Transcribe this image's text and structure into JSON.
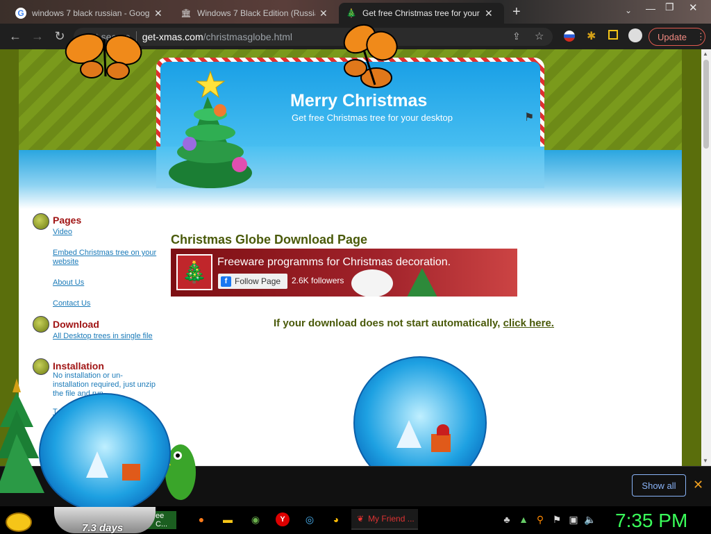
{
  "tabs": [
    {
      "title": "windows 7 black russian - Googl",
      "icon": "google-icon"
    },
    {
      "title": "Windows 7 Black Edition (Russia",
      "icon": "archive-icon"
    },
    {
      "title": "Get free Christmas tree for your",
      "icon": "tree-icon",
      "active": true
    }
  ],
  "toolbar": {
    "not_secure": "Not secure",
    "url_domain": "get-xmas.com",
    "url_path": "/christmasglobe.html",
    "update_label": "Update"
  },
  "banner": {
    "title": "Merry Christmas",
    "subtitle": "Get free Christmas tree for your desktop"
  },
  "sidebar": {
    "pages_heading": "Pages",
    "pages_links": [
      "Video",
      "Embed Christmas tree on your website",
      "About Us",
      "Contact Us"
    ],
    "download_heading": "Download",
    "download_link": "All Desktop trees in single file",
    "installation_heading": "Installation",
    "installation_text": "No installation or un-installation required, just unzip the file and run.",
    "truncated": "T"
  },
  "main": {
    "title": "Christmas Globe Download Page",
    "fb": {
      "page_name": "Freeware programms for Christmas decoration.",
      "follow_label": "Follow Page",
      "followers": "2.6K followers"
    },
    "download_msg": "If your download does not start automatically, ",
    "download_link": "click here."
  },
  "shelf": {
    "show_all": "Show all"
  },
  "taskbar": {
    "running_app": "My Friend ...",
    "left_app": "ee C...",
    "clock": "7:35 PM"
  },
  "gadget": {
    "label": "7.3 days"
  },
  "colors": {
    "page_green": "#5a6e0c",
    "heading_red": "#a01414",
    "link_blue": "#1a7ab8",
    "clock_green": "#3aff5a"
  }
}
